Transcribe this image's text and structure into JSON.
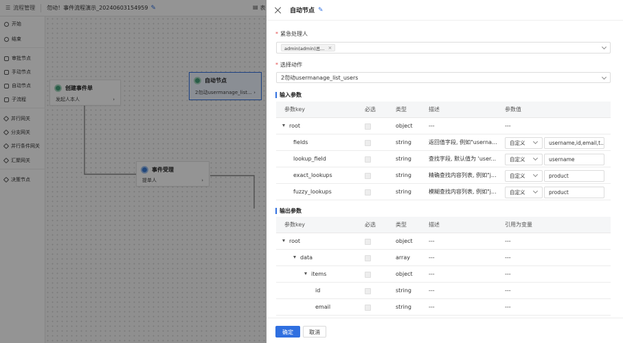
{
  "topbar": {
    "breadcrumb": "流程管理",
    "title": "勿动！事件流程演示_20240603154959",
    "right_text": "表"
  },
  "palette": {
    "items": [
      {
        "label": "开始",
        "icon": "start-icon"
      },
      {
        "label": "结束",
        "icon": "end-icon"
      },
      {
        "label": "审批节点",
        "icon": "approval-node-icon"
      },
      {
        "label": "手动节点",
        "icon": "manual-node-icon"
      },
      {
        "label": "自动节点",
        "icon": "auto-node-icon"
      },
      {
        "label": "子流程",
        "icon": "subprocess-icon"
      },
      {
        "label": "并行网关",
        "icon": "parallel-gateway-icon"
      },
      {
        "label": "分支网关",
        "icon": "branch-gateway-icon"
      },
      {
        "label": "并行条件网关",
        "icon": "parallel-condition-gateway-icon"
      },
      {
        "label": "汇聚网关",
        "icon": "merge-gateway-icon"
      },
      {
        "label": "决策节点",
        "icon": "decision-node-icon"
      }
    ]
  },
  "canvas": {
    "nodes": [
      {
        "title": "创建事件单",
        "sub": "发起人本人"
      },
      {
        "title": "自动节点",
        "sub": "2勿动usermanage_list..."
      },
      {
        "title": "事件受理",
        "sub": "提单人"
      }
    ]
  },
  "drawer": {
    "title": "自动节点",
    "handler_label": "紧急处理人",
    "handler_tag": "admin(admin)总...",
    "action_label": "选择动作",
    "action_value": "2勿动usermanage_list_users",
    "input_section": "输入参数",
    "input_headers": [
      "参数key",
      "必选",
      "类型",
      "描述",
      "参数值"
    ],
    "input_rows": [
      {
        "key": "root",
        "type": "object",
        "desc": "---",
        "mode": "",
        "value": "---"
      },
      {
        "key": "fields",
        "type": "string",
        "desc": "返回值字段, 例如\"userna...",
        "mode": "自定义",
        "value": "username,id,email,t..."
      },
      {
        "key": "lookup_field",
        "type": "string",
        "desc": "查找字段, 默认值为 'user...",
        "mode": "自定义",
        "value": "username"
      },
      {
        "key": "exact_lookups",
        "type": "string",
        "desc": "精确查找内容列表, 例如\"j...",
        "mode": "自定义",
        "value": "product"
      },
      {
        "key": "fuzzy_lookups",
        "type": "string",
        "desc": "模糊查找内容列表, 例如\"j...",
        "mode": "自定义",
        "value": "product"
      }
    ],
    "output_section": "输出参数",
    "output_headers": [
      "参数key",
      "必选",
      "类型",
      "描述",
      "引用为变量"
    ],
    "output_rows": [
      {
        "key": "root",
        "type": "object",
        "desc": "---",
        "ref": "---"
      },
      {
        "key": "data",
        "type": "array",
        "desc": "---",
        "ref": "---"
      },
      {
        "key": "items",
        "type": "object",
        "desc": "---",
        "ref": "---"
      },
      {
        "key": "id",
        "type": "string",
        "desc": "---",
        "ref": "---"
      },
      {
        "key": "email",
        "type": "string",
        "desc": "---",
        "ref": "---"
      }
    ],
    "confirm_label": "确定",
    "cancel_label": "取消"
  },
  "colors": {
    "accent": "#2f6fe0",
    "required": "#e34d4d",
    "mask": "rgba(0,0,0,0.42)"
  }
}
